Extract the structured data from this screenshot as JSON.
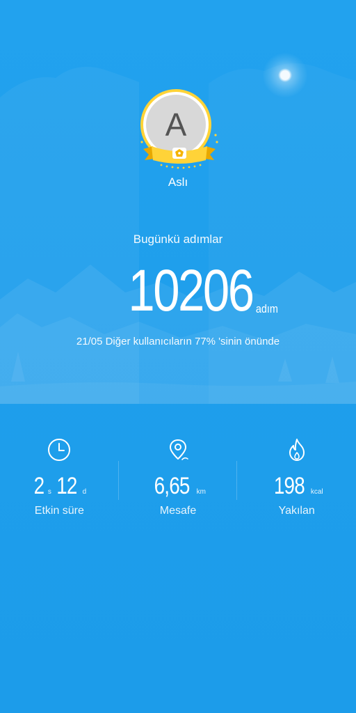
{
  "profile": {
    "avatar_initial": "A",
    "name": "Aslı"
  },
  "today": {
    "label": "Bugünkü adımlar",
    "steps": "10206",
    "unit": "adım",
    "rank_text": "21/05 Diğer kullanıcıların 77% 'sinin önünde"
  },
  "stats": {
    "active_time": {
      "hours": "2",
      "hours_unit": "s",
      "minutes": "12",
      "minutes_unit": "d",
      "label": "Etkin süre",
      "icon": "clock-icon"
    },
    "distance": {
      "value": "6,65",
      "unit": "km",
      "label": "Mesafe",
      "icon": "location-pin-icon"
    },
    "calories": {
      "value": "198",
      "unit": "kcal",
      "label": "Yakılan",
      "icon": "flame-icon"
    }
  },
  "colors": {
    "background": "#1ea0ec",
    "badge_gold": "#ffd338",
    "badge_ribbon": "#f5b400"
  }
}
